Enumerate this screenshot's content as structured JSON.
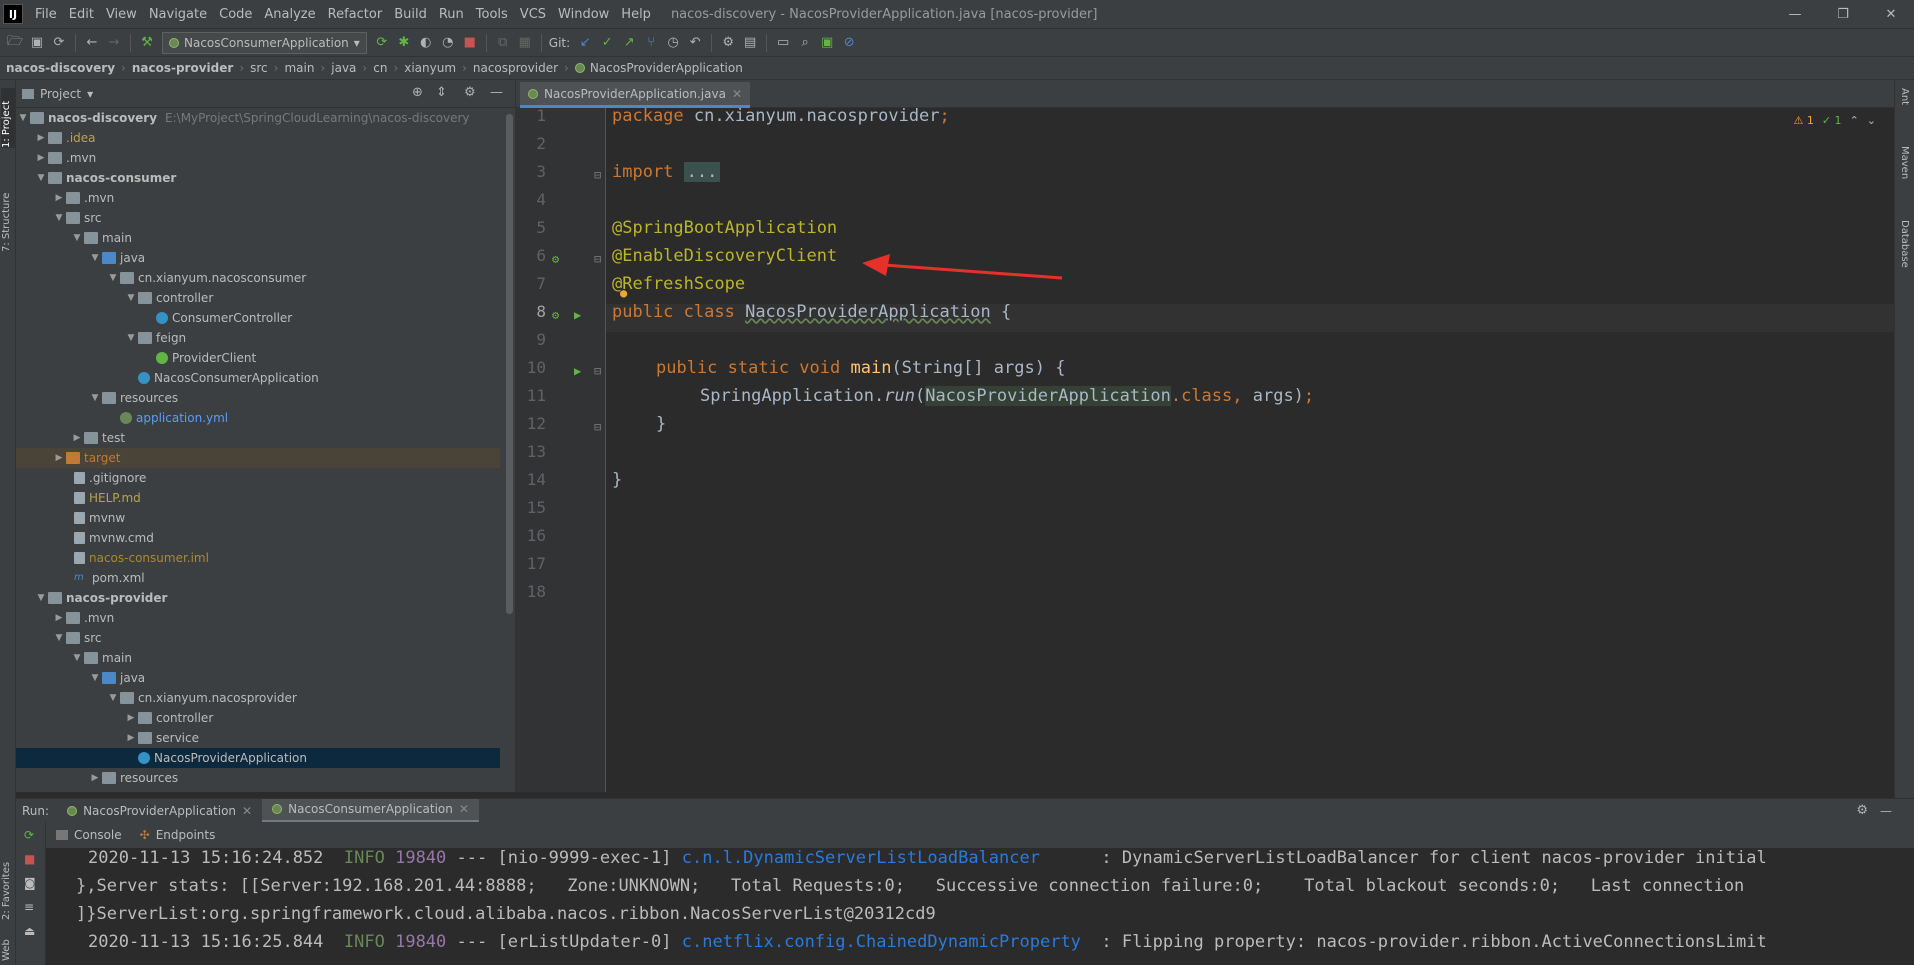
{
  "menubar": {
    "logo": "IJ",
    "items": [
      "File",
      "Edit",
      "View",
      "Navigate",
      "Code",
      "Analyze",
      "Refactor",
      "Build",
      "Run",
      "Tools",
      "VCS",
      "Window",
      "Help"
    ],
    "title": "nacos-discovery - NacosProviderApplication.java [nacos-provider]",
    "controls": {
      "minimize": "—",
      "maximize": "❐",
      "close": "✕"
    }
  },
  "toolbar": {
    "run_config": "NacosConsumerApplication",
    "git_label": "Git:"
  },
  "breadcrumb": [
    "nacos-discovery",
    "nacos-provider",
    "src",
    "main",
    "java",
    "cn",
    "xianyum",
    "nacosprovider",
    "NacosProviderApplication"
  ],
  "left_strip": {
    "project": "1: Project",
    "structure": "7: Structure",
    "favorites": "2: Favorites",
    "web": "Web"
  },
  "right_strip": {
    "ant": "Ant",
    "maven": "Maven",
    "database": "Database"
  },
  "project_panel": {
    "title": "Project",
    "tree": [
      {
        "label": "nacos-discovery",
        "extra": "E:\\MyProject\\SpringCloudLearning\\nacos-discovery"
      },
      {
        "label": ".idea"
      },
      {
        "label": ".mvn"
      },
      {
        "label": "nacos-consumer"
      },
      {
        "label": ".mvn"
      },
      {
        "label": "src"
      },
      {
        "label": "main"
      },
      {
        "label": "java"
      },
      {
        "label": "cn.xianyum.nacosconsumer"
      },
      {
        "label": "controller"
      },
      {
        "label": "ConsumerController"
      },
      {
        "label": "feign"
      },
      {
        "label": "ProviderClient"
      },
      {
        "label": "NacosConsumerApplication"
      },
      {
        "label": "resources"
      },
      {
        "label": "application.yml"
      },
      {
        "label": "test"
      },
      {
        "label": "target"
      },
      {
        "label": ".gitignore"
      },
      {
        "label": "HELP.md"
      },
      {
        "label": "mvnw"
      },
      {
        "label": "mvnw.cmd"
      },
      {
        "label": "nacos-consumer.iml"
      },
      {
        "label": "pom.xml"
      },
      {
        "label": "nacos-provider"
      },
      {
        "label": ".mvn"
      },
      {
        "label": "src"
      },
      {
        "label": "main"
      },
      {
        "label": "java"
      },
      {
        "label": "cn.xianyum.nacosprovider"
      },
      {
        "label": "controller"
      },
      {
        "label": "service"
      },
      {
        "label": "NacosProviderApplication"
      },
      {
        "label": "resources"
      }
    ]
  },
  "editor": {
    "tab": "NacosProviderApplication.java",
    "inspections": {
      "warnings": "⚠ 1",
      "ok": "✓ 1"
    },
    "line_numbers": [
      "1",
      "2",
      "3",
      "4",
      "5",
      "6",
      "7",
      "8",
      "9",
      "10",
      "11",
      "12",
      "13",
      "14",
      "15",
      "16",
      "17",
      "18"
    ],
    "code": {
      "l1_kw": "package",
      "l1_rest": " cn.xianyum.nacosprovider",
      "l1_semi": ";",
      "l3_kw": "import",
      "l3_fold": "...",
      "l5": "@SpringBootApplication",
      "l6": "@EnableDiscoveryClient",
      "l7": "@RefreshScope",
      "l8_kw": "public class",
      "l8_name": "NacosProviderApplication",
      "l8_brace": " {",
      "l10_kw": "public static void",
      "l10_fn": "main",
      "l10_rest": "(String[] args) {",
      "l11_a": "SpringApplication.",
      "l11_run": "run",
      "l11_b": "(",
      "l11_cls": "NacosProviderApplication",
      "l11_c": ".class,",
      "l11_d": " args)",
      "l11_e": ";",
      "l12": "}",
      "l14": "}"
    }
  },
  "run_panel": {
    "label": "Run:",
    "tabs": [
      "NacosProviderApplication",
      "NacosConsumerApplication"
    ],
    "subtabs": [
      "Console",
      "Endpoints"
    ],
    "console": [
      {
        "ts": "2020-11-13 15:16:24.852",
        "level": "INFO",
        "pid": "19840",
        "sep": "---",
        "thread": "[nio-9999-exec-1]",
        "logger": "c.n.l.DynamicServerListLoadBalancer",
        "msg": ": DynamicServerListLoadBalancer for client nacos-provider initial"
      },
      {
        "text": "},Server stats: [[Server:192.168.201.44:8888;   Zone:UNKNOWN;   Total Requests:0;   Successive connection failure:0;    Total blackout seconds:0;   Last connection"
      },
      {
        "text": "]}ServerList:org.springframework.cloud.alibaba.nacos.ribbon.NacosServerList@20312cd9"
      },
      {
        "ts": "2020-11-13 15:16:25.844",
        "level": "INFO",
        "pid": "19840",
        "sep": "---",
        "thread": "[erListUpdater-0]",
        "logger": "c.netflix.config.ChainedDynamicProperty",
        "msg": ": Flipping property: nacos-provider.ribbon.ActiveConnectionsLimit"
      }
    ]
  },
  "colors": {
    "annotation_arrow": "#e8302a",
    "accent": "#4a88c7"
  }
}
